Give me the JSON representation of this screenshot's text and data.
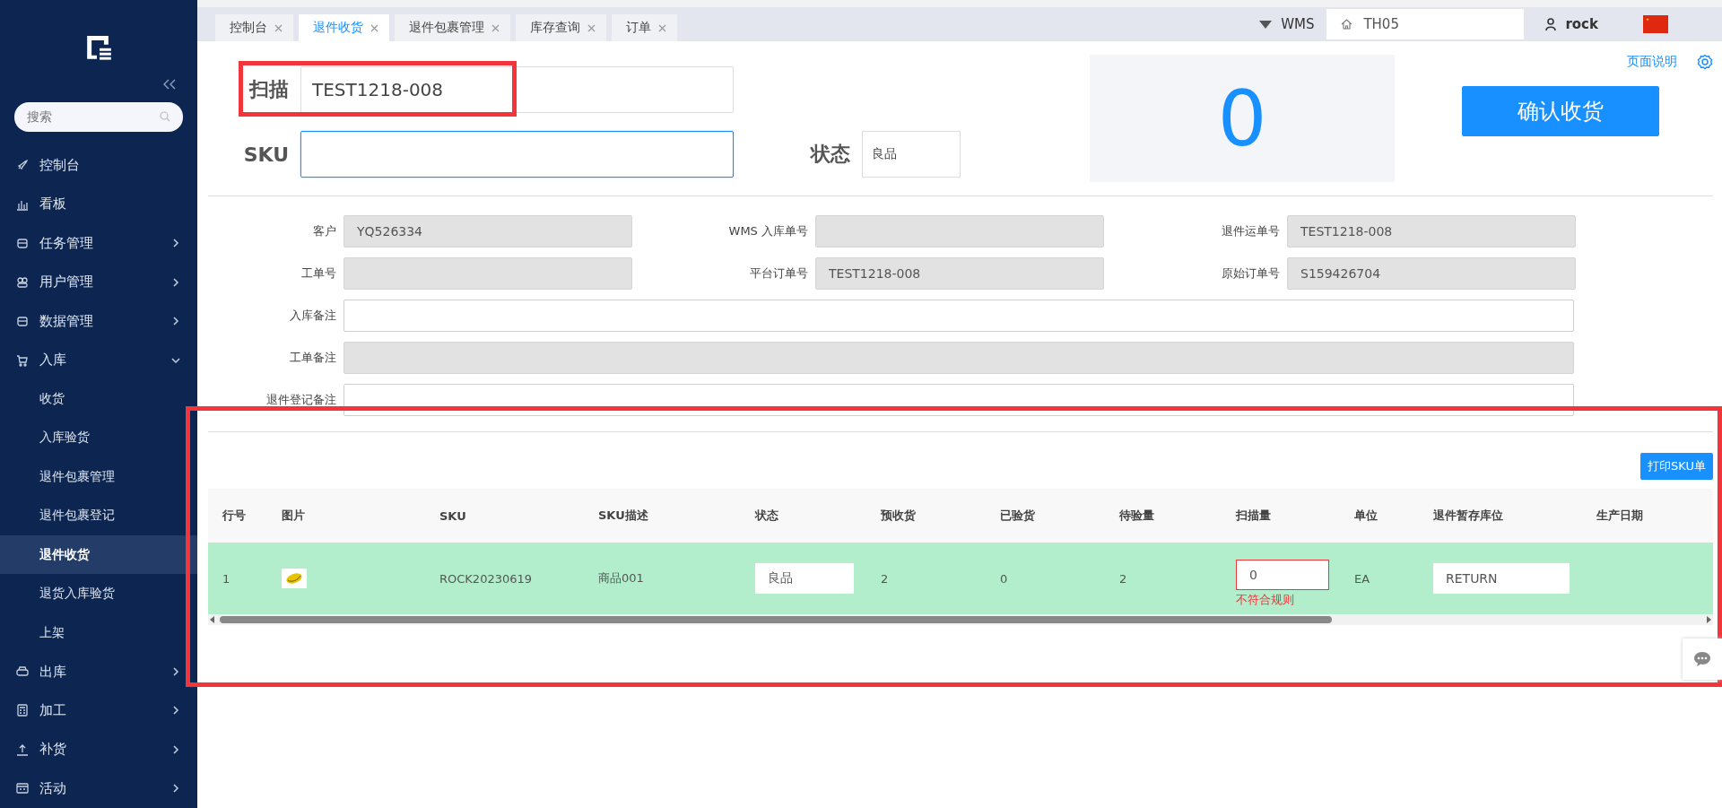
{
  "sidebar": {
    "search": {
      "placeholder": "搜索"
    },
    "items": [
      {
        "label": "控制台"
      },
      {
        "label": "看板"
      },
      {
        "label": "任务管理",
        "expanded": false
      },
      {
        "label": "用户管理",
        "expanded": false
      },
      {
        "label": "数据管理",
        "expanded": false
      },
      {
        "label": "入库",
        "expanded": true,
        "children": [
          {
            "label": "收货",
            "selected": false
          },
          {
            "label": "入库验货",
            "selected": false
          },
          {
            "label": "退件包裹管理",
            "selected": false
          },
          {
            "label": "退件包裹登记",
            "selected": false
          },
          {
            "label": "退件收货",
            "selected": true
          },
          {
            "label": "退货入库验货",
            "selected": false
          },
          {
            "label": "上架",
            "selected": false
          }
        ]
      },
      {
        "label": "出库",
        "expanded": false
      },
      {
        "label": "加工",
        "expanded": false
      },
      {
        "label": "补货",
        "expanded": false
      },
      {
        "label": "活动",
        "expanded": false
      }
    ]
  },
  "tabs": [
    {
      "label": "控制台",
      "selected": false
    },
    {
      "label": "退件收货",
      "selected": true
    },
    {
      "label": "退件包裹管理",
      "selected": false
    },
    {
      "label": "库存查询",
      "selected": false
    },
    {
      "label": "订单",
      "selected": false
    }
  ],
  "header": {
    "system": "WMS",
    "warehouse": "TH05",
    "user": "rock"
  },
  "scan": {
    "label": "扫描",
    "value": "TEST1218-008",
    "highlight": true
  },
  "sku": {
    "label": "SKU",
    "focused": true
  },
  "status": {
    "label": "状态",
    "value": "良品"
  },
  "counter": "0",
  "confirm_button": "确认收货",
  "help_link": "页面说明",
  "info_fields": [
    {
      "kind": "short",
      "label": "客户",
      "value": "YQ526334",
      "disabled": true
    },
    {
      "kind": "short",
      "label": "WMS 入库单号",
      "disabled": true
    },
    {
      "kind": "short",
      "label": "退件运单号",
      "value": "TEST1218-008",
      "disabled": true
    },
    {
      "kind": "short",
      "label": "工单号",
      "disabled": true
    },
    {
      "kind": "short",
      "label": "平台订单号",
      "value": "TEST1218-008",
      "disabled": true
    },
    {
      "kind": "short",
      "label": "原始订单号",
      "value": "S159426704",
      "disabled": true
    },
    {
      "kind": "wide",
      "label": "入库备注",
      "disabled": false
    },
    {
      "kind": "wide",
      "label": "工单备注",
      "disabled": true
    },
    {
      "kind": "wide",
      "label": "退件登记备注",
      "disabled": false
    }
  ],
  "print_button": "打印SKU单",
  "table": {
    "highlight": true,
    "columns": [
      "行号",
      "图片",
      "SKU",
      "SKU描述",
      "状态",
      "预收货",
      "已验货",
      "待验量",
      "扫描量",
      "单位",
      "退件暂存库位",
      "生产日期"
    ],
    "rows": [
      {
        "selected": true,
        "line": "1",
        "sku": "ROCK20230619",
        "description": "商品001",
        "status": "良品",
        "expected": "2",
        "inspected": "0",
        "pending": "2",
        "scan_qty": "0",
        "scan_error": "不符合规则",
        "unit": "EA",
        "location": "RETURN"
      }
    ]
  }
}
